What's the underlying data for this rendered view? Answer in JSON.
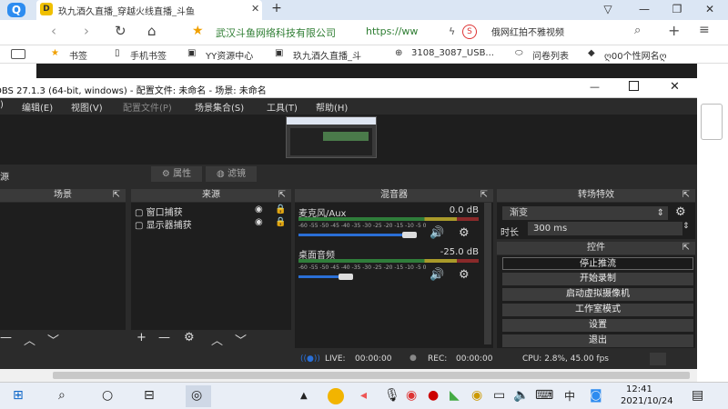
{
  "browser": {
    "logo": "Q",
    "active_tab_title": "玖九酒久直播_穿越火线直播_斗鱼",
    "tab_close": "✕",
    "new_tab": "+",
    "address": {
      "site_name": "武汉斗鱼网络科技有限公司",
      "url": "https://ww"
    },
    "suggest": "俄网红拍不雅视频",
    "bookmarks": [
      "书签",
      "手机书签",
      "YY资源中心",
      "玖九酒久直播_斗",
      "3108_3087_USB...",
      "问卷列表",
      "ღ00个性网名ღ"
    ]
  },
  "obs": {
    "title": "OBS 27.1.3 (64-bit, windows) - 配置文件: 未命名 - 场景: 未命名",
    "menus": [
      "编辑(E)",
      "视图(V)",
      "配置文件(P)",
      "场景集合(S)",
      "工具(T)",
      "帮助(H)"
    ],
    "source_toolbar": {
      "left": "源",
      "props": "属性",
      "filters": "滤镜"
    },
    "docks": {
      "scenes": "场景",
      "sources": "来源",
      "mixer": "混音器",
      "transitions": "转场特效",
      "controls": "控件"
    },
    "sources": [
      "窗口捕获",
      "显示器捕获"
    ],
    "mixer": [
      {
        "name": "麦克风/Aux",
        "db": "0.0 dB",
        "level": 0.9
      },
      {
        "name": "桌面音频",
        "db": "-25.0 dB",
        "level": 0.38
      }
    ],
    "meter_ticks": "-60 -55 -50 -45 -40 -35 -30 -25 -20 -15 -10 -5 0",
    "transitions": {
      "type": "渐变",
      "duration_label": "时长",
      "duration": "300 ms"
    },
    "controls": [
      "停止推流",
      "开始录制",
      "启动虚拟摄像机",
      "工作室模式",
      "设置",
      "退出"
    ],
    "status": {
      "live_label": "LIVE:",
      "live_time": "00:00:00",
      "rec_label": "REC:",
      "rec_time": "00:00:00",
      "cpu": "CPU: 2.8%, 45.00 fps"
    }
  },
  "taskbar": {
    "time": "12:41",
    "date": "2021/10/24",
    "ime": "中"
  }
}
